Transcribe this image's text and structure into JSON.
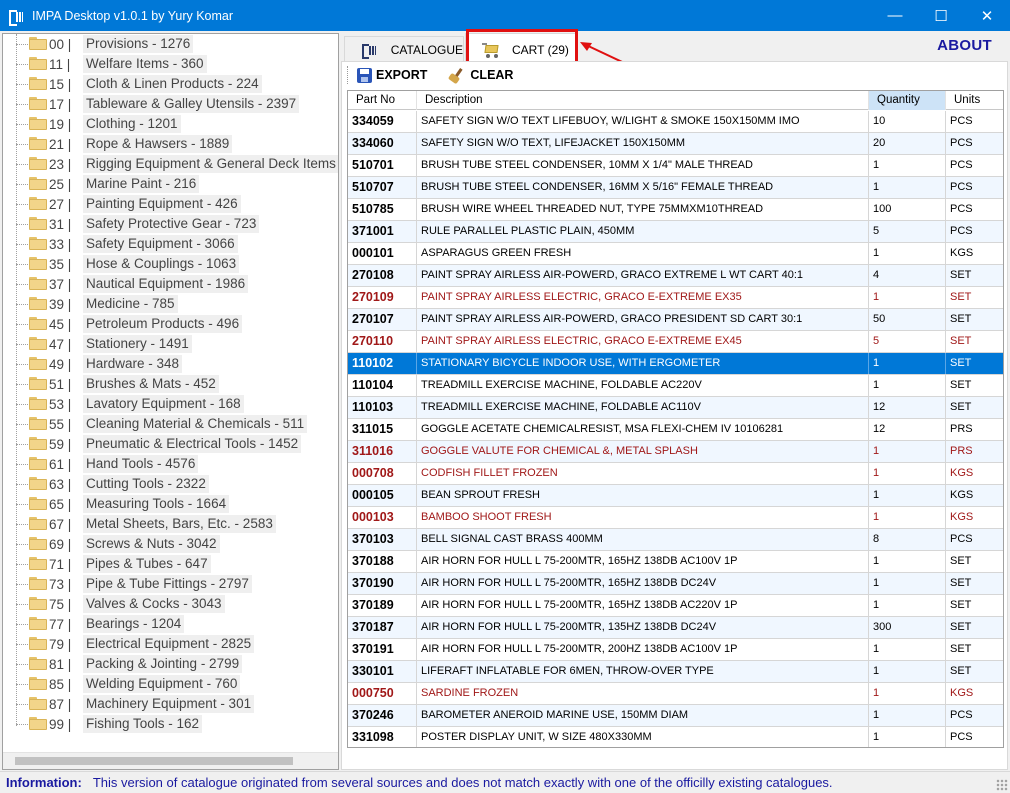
{
  "window": {
    "title": "IMPA Desktop v1.0.1 by Yury Komar",
    "controls": [
      "—",
      "☐",
      "✕"
    ]
  },
  "tree": {
    "items": [
      {
        "code": "00 |",
        "label": "Provisions - 1276"
      },
      {
        "code": "11 |",
        "label": "Welfare Items - 360"
      },
      {
        "code": "15 |",
        "label": "Cloth & Linen Products - 224"
      },
      {
        "code": "17 |",
        "label": "Tableware & Galley Utensils - 2397"
      },
      {
        "code": "19 |",
        "label": "Clothing - 1201"
      },
      {
        "code": "21 |",
        "label": "Rope & Hawsers - 1889"
      },
      {
        "code": "23 |",
        "label": "Rigging Equipment & General Deck Items -"
      },
      {
        "code": "25 |",
        "label": "Marine Paint - 216"
      },
      {
        "code": "27 |",
        "label": "Painting Equipment - 426"
      },
      {
        "code": "31 |",
        "label": "Safety Protective Gear - 723"
      },
      {
        "code": "33 |",
        "label": "Safety Equipment - 3066"
      },
      {
        "code": "35 |",
        "label": "Hose & Couplings - 1063"
      },
      {
        "code": "37 |",
        "label": "Nautical Equipment - 1986"
      },
      {
        "code": "39 |",
        "label": "Medicine - 785"
      },
      {
        "code": "45 |",
        "label": "Petroleum Products  - 496"
      },
      {
        "code": "47 |",
        "label": "Stationery - 1491"
      },
      {
        "code": "49 |",
        "label": "Hardware - 348"
      },
      {
        "code": "51 |",
        "label": "Brushes & Mats - 452"
      },
      {
        "code": "53 |",
        "label": "Lavatory Equipment - 168"
      },
      {
        "code": "55 |",
        "label": "Cleaning Material & Chemicals - 511"
      },
      {
        "code": "59 |",
        "label": "Pneumatic & Electrical Tools - 1452"
      },
      {
        "code": "61 |",
        "label": "Hand Tools - 4576"
      },
      {
        "code": "63 |",
        "label": "Cutting Tools - 2322"
      },
      {
        "code": "65 |",
        "label": "Measuring Tools - 1664"
      },
      {
        "code": "67 |",
        "label": "Metal Sheets, Bars, Etc. - 2583"
      },
      {
        "code": "69 |",
        "label": "Screws & Nuts - 3042"
      },
      {
        "code": "71 |",
        "label": "Pipes & Tubes - 647"
      },
      {
        "code": "73 |",
        "label": "Pipe & Tube Fittings - 2797"
      },
      {
        "code": "75 |",
        "label": "Valves & Cocks - 3043"
      },
      {
        "code": "77 |",
        "label": "Bearings - 1204"
      },
      {
        "code": "79 |",
        "label": "Electrical Equipment - 2825"
      },
      {
        "code": "81 |",
        "label": "Packing & Jointing - 2799"
      },
      {
        "code": "85 |",
        "label": "Welding Equipment - 760"
      },
      {
        "code": "87 |",
        "label": "Machinery Equipment - 301"
      },
      {
        "code": "99 |",
        "label": "Fishing Tools - 162"
      }
    ]
  },
  "tabs": {
    "catalogue": "CATALOGUE",
    "cart": "CART (29)",
    "about": "ABOUT"
  },
  "toolbar": {
    "export": "EXPORT",
    "clear": "CLEAR"
  },
  "grid": {
    "columns": [
      "Part No",
      "Description",
      "Quantity",
      "Units"
    ],
    "rows": [
      {
        "pn": "334059",
        "desc": "SAFETY SIGN W/O TEXT LIFEBUOY, W/LIGHT & SMOKE 150X150MM IMO",
        "qty": "10",
        "unit": "PCS",
        "state": "normal"
      },
      {
        "pn": "334060",
        "desc": "SAFETY SIGN W/O TEXT, LIFEJACKET 150X150MM",
        "qty": "20",
        "unit": "PCS",
        "state": "normal"
      },
      {
        "pn": "510701",
        "desc": "BRUSH TUBE STEEL CONDENSER, 10MM X 1/4\" MALE THREAD",
        "qty": "1",
        "unit": "PCS",
        "state": "normal"
      },
      {
        "pn": "510707",
        "desc": "BRUSH TUBE STEEL CONDENSER, 16MM X 5/16\" FEMALE THREAD",
        "qty": "1",
        "unit": "PCS",
        "state": "normal"
      },
      {
        "pn": "510785",
        "desc": "BRUSH WIRE WHEEL THREADED NUT, TYPE 75MMXM10THREAD",
        "qty": "100",
        "unit": "PCS",
        "state": "normal"
      },
      {
        "pn": "371001",
        "desc": "RULE PARALLEL PLASTIC PLAIN, 450MM",
        "qty": "5",
        "unit": "PCS",
        "state": "normal"
      },
      {
        "pn": "000101",
        "desc": "ASPARAGUS GREEN FRESH",
        "qty": "1",
        "unit": "KGS",
        "state": "normal"
      },
      {
        "pn": "270108",
        "desc": "PAINT SPRAY AIRLESS AIR-POWERD, GRACO EXTREME L WT CART 40:1",
        "qty": "4",
        "unit": "SET",
        "state": "normal"
      },
      {
        "pn": "270109",
        "desc": "PAINT SPRAY AIRLESS ELECTRIC, GRACO E-EXTREME EX35",
        "qty": "1",
        "unit": "SET",
        "state": "red"
      },
      {
        "pn": "270107",
        "desc": "PAINT SPRAY AIRLESS AIR-POWERD, GRACO PRESIDENT SD CART 30:1",
        "qty": "50",
        "unit": "SET",
        "state": "normal"
      },
      {
        "pn": "270110",
        "desc": "PAINT SPRAY AIRLESS ELECTRIC, GRACO E-EXTREME EX45",
        "qty": "5",
        "unit": "SET",
        "state": "red"
      },
      {
        "pn": "110102",
        "desc": "STATIONARY BICYCLE INDOOR USE, WITH ERGOMETER",
        "qty": "1",
        "unit": "SET",
        "state": "selected"
      },
      {
        "pn": "110104",
        "desc": "TREADMILL EXERCISE MACHINE, FOLDABLE AC220V",
        "qty": "1",
        "unit": "SET",
        "state": "normal"
      },
      {
        "pn": "110103",
        "desc": "TREADMILL EXERCISE MACHINE, FOLDABLE AC110V",
        "qty": "12",
        "unit": "SET",
        "state": "normal"
      },
      {
        "pn": "311015",
        "desc": "GOGGLE ACETATE CHEMICALRESIST, MSA FLEXI-CHEM IV 10106281",
        "qty": "12",
        "unit": "PRS",
        "state": "normal"
      },
      {
        "pn": "311016",
        "desc": "GOGGLE VALUTE FOR CHEMICAL &, METAL SPLASH",
        "qty": "1",
        "unit": "PRS",
        "state": "red"
      },
      {
        "pn": "000708",
        "desc": "CODFISH FILLET FROZEN",
        "qty": "1",
        "unit": "KGS",
        "state": "red"
      },
      {
        "pn": "000105",
        "desc": "BEAN SPROUT FRESH",
        "qty": "1",
        "unit": "KGS",
        "state": "normal"
      },
      {
        "pn": "000103",
        "desc": "BAMBOO SHOOT FRESH",
        "qty": "1",
        "unit": "KGS",
        "state": "red"
      },
      {
        "pn": "370103",
        "desc": "BELL SIGNAL CAST BRASS 400MM",
        "qty": "8",
        "unit": "PCS",
        "state": "normal"
      },
      {
        "pn": "370188",
        "desc": "AIR HORN FOR HULL L 75-200MTR, 165HZ 138DB AC100V 1P",
        "qty": "1",
        "unit": "SET",
        "state": "normal"
      },
      {
        "pn": "370190",
        "desc": "AIR HORN FOR HULL L 75-200MTR, 165HZ 138DB DC24V",
        "qty": "1",
        "unit": "SET",
        "state": "normal"
      },
      {
        "pn": "370189",
        "desc": "AIR HORN FOR HULL L 75-200MTR, 165HZ 138DB AC220V 1P",
        "qty": "1",
        "unit": "SET",
        "state": "normal"
      },
      {
        "pn": "370187",
        "desc": "AIR HORN FOR HULL L 75-200MTR, 135HZ 138DB DC24V",
        "qty": "300",
        "unit": "SET",
        "state": "normal"
      },
      {
        "pn": "370191",
        "desc": "AIR HORN FOR HULL L 75-200MTR, 200HZ 138DB AC100V 1P",
        "qty": "1",
        "unit": "SET",
        "state": "normal"
      },
      {
        "pn": "330101",
        "desc": "LIFERAFT INFLATABLE FOR 6MEN, THROW-OVER TYPE",
        "qty": "1",
        "unit": "SET",
        "state": "normal"
      },
      {
        "pn": "000750",
        "desc": "SARDINE FROZEN",
        "qty": "1",
        "unit": "KGS",
        "state": "red"
      },
      {
        "pn": "370246",
        "desc": "BAROMETER ANEROID MARINE USE, 150MM DIAM",
        "qty": "1",
        "unit": "PCS",
        "state": "normal"
      },
      {
        "pn": "331098",
        "desc": "POSTER DISPLAY UNIT, W SIZE 480X330MM",
        "qty": "1",
        "unit": "PCS",
        "state": "normal"
      }
    ]
  },
  "status": {
    "label": "Information:",
    "message": "This version of catalogue originated from several sources and does not match exactly with one of the officilly existing catalogues."
  },
  "colors": {
    "titlebar": "#0078d7",
    "selection": "#0078d7",
    "missing_item_text": "#a01818",
    "info_text": "#1a1aa0",
    "annotation_red": "#e01010"
  }
}
